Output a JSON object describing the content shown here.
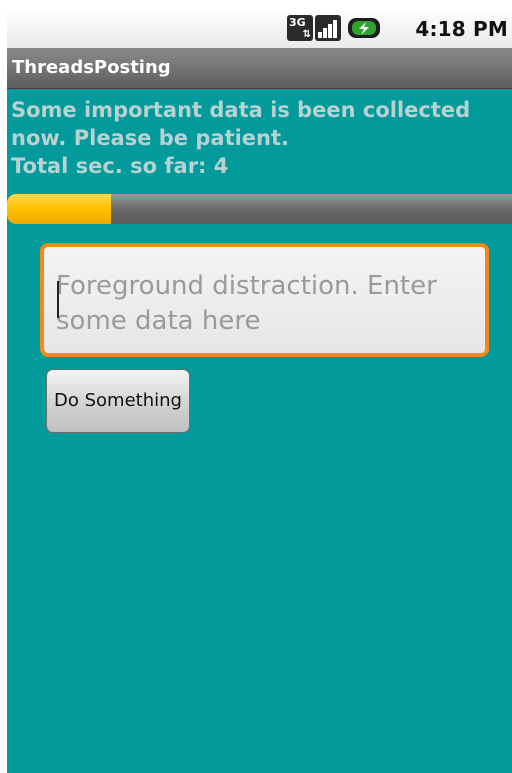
{
  "status_bar": {
    "time": "4:18 PM",
    "network_label": "3G",
    "icons": [
      "3g-data-icon",
      "signal-strength-icon",
      "battery-charging-icon"
    ]
  },
  "app": {
    "title": "ThreadsPosting"
  },
  "message": {
    "line1": "Some important data is been collected",
    "line2": "now. Please be patient.",
    "line3": "Total sec. so far: 4"
  },
  "progress": {
    "fraction": 0.205
  },
  "input": {
    "placeholder": "Foreground distraction. Enter some data here",
    "value": ""
  },
  "button": {
    "label": "Do Something"
  },
  "colors": {
    "background": "#029a9a",
    "message_text": "#b9d1d1",
    "progress_fill": "#ffc200",
    "field_focus_border": "#f08a1c"
  }
}
